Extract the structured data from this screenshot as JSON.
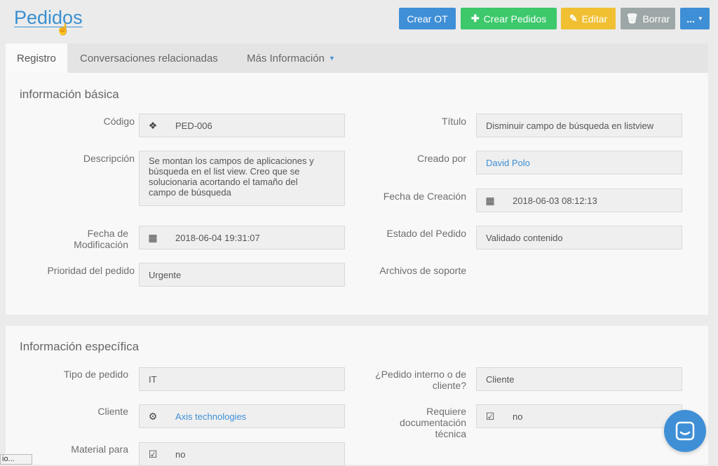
{
  "header": {
    "title": "Pedidos",
    "buttons": {
      "crear_ot": "Crear OT",
      "crear_pedidos": "Crear Pedidos",
      "editar": "Editar",
      "borrar": "Borrar",
      "more": "..."
    }
  },
  "tabs": [
    {
      "label": "Registro"
    },
    {
      "label": "Conversaciones relacionadas"
    },
    {
      "label": "Más Información"
    }
  ],
  "basic": {
    "title": "información básica",
    "codigo": {
      "label": "Código",
      "value": "PED-006",
      "icon": "cubes-icon"
    },
    "titulo": {
      "label": "Título",
      "value": "Disminuir campo de búsqueda en listview"
    },
    "descripcion": {
      "label": "Descripción",
      "lines": [
        "Se montan los campos de aplicaciones y",
        "búsqueda en el list view. Creo que se",
        "solucionaria acortando el tamaño del",
        "campo de búsqueda"
      ]
    },
    "creado_por": {
      "label": "Creado por",
      "value": "David Polo"
    },
    "fecha_creacion": {
      "label": "Fecha de Creación",
      "value": "2018-06-03 08:12:13",
      "icon": "calendar-icon"
    },
    "fecha_modificacion": {
      "label_line1": "Fecha de",
      "label_line2": "Modificación",
      "value": "2018-06-04 19:31:07",
      "icon": "calendar-icon"
    },
    "estado": {
      "label": "Estado del Pedido",
      "value": "Validado contenido"
    },
    "prioridad": {
      "label": "Prioridad del pedido",
      "value": "Urgente"
    },
    "archivos": {
      "label": "Archivos de soporte"
    }
  },
  "specific": {
    "title": "Información específica",
    "tipo": {
      "label": "Tipo de pedido",
      "value": "IT"
    },
    "interno": {
      "label_line1": "¿Pedido interno o de",
      "label_line2": "cliente?",
      "value": "Cliente"
    },
    "cliente": {
      "label": "Cliente",
      "value": "Axis technologies",
      "icon": "gears-icon"
    },
    "documentacion": {
      "label_line1": "Requiere",
      "label_line2": "documentación",
      "label_line3": "técnica",
      "value": "no",
      "icon": "checkbox-icon"
    },
    "material": {
      "label": "Material para",
      "value": "no",
      "icon": "checkbox-icon"
    }
  },
  "status_bar": {
    "text": "io..."
  },
  "colors": {
    "primary": "#3f8fd6",
    "success": "#3cc86b",
    "warning": "#f0c032",
    "muted": "#9ea7a8"
  }
}
